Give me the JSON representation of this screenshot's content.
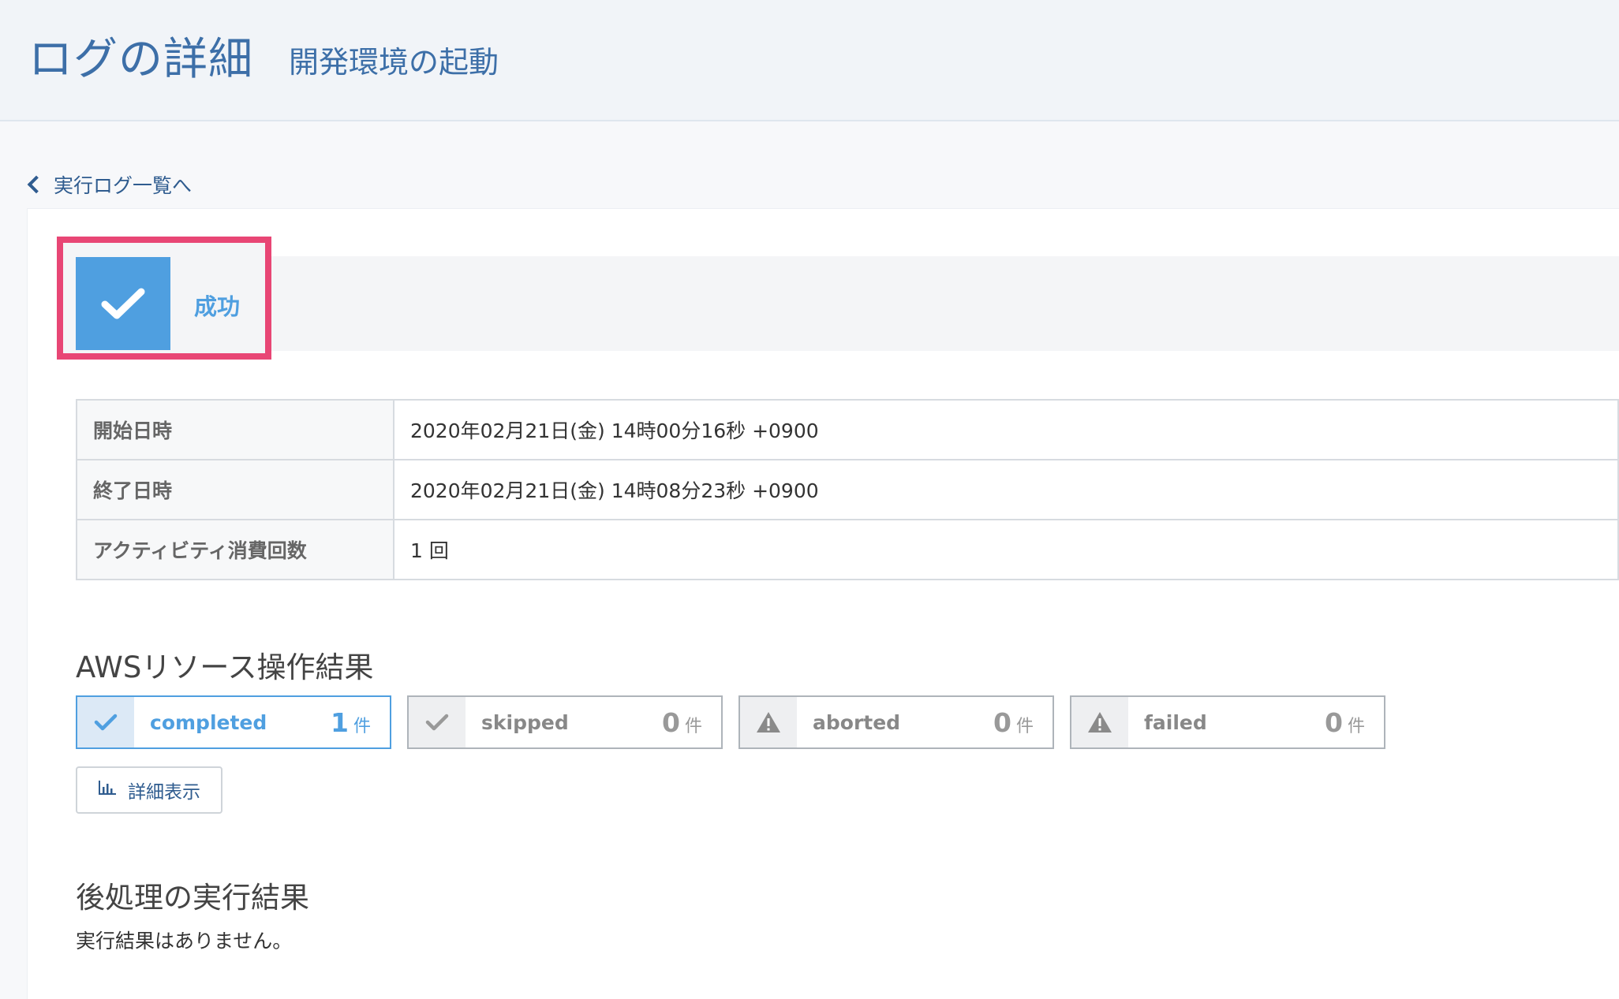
{
  "header": {
    "title": "ログの詳細",
    "subtitle": "開発環境の起動"
  },
  "back_link": {
    "label": "実行ログ一覧へ"
  },
  "status": {
    "label": "成功",
    "icon": "check-icon",
    "color": "#4f9fe0",
    "highlight_color": "#e84675"
  },
  "info_rows": [
    {
      "label": "開始日時",
      "value": "2020年02月21日(金) 14時00分16秒 +0900"
    },
    {
      "label": "終了日時",
      "value": "2020年02月21日(金) 14時08分23秒 +0900"
    },
    {
      "label": "アクティビティ消費回数",
      "value": "1 回"
    }
  ],
  "aws_results": {
    "title": "AWSリソース操作結果",
    "unit": "件",
    "items": [
      {
        "label": "completed",
        "count": "1",
        "icon": "check-icon"
      },
      {
        "label": "skipped",
        "count": "0",
        "icon": "check-icon"
      },
      {
        "label": "aborted",
        "count": "0",
        "icon": "warning-icon"
      },
      {
        "label": "failed",
        "count": "0",
        "icon": "warning-icon"
      }
    ],
    "detail_button": {
      "label": "詳細表示",
      "icon": "bar-chart-icon"
    }
  },
  "post_process": {
    "title": "後処理の実行結果",
    "message": "実行結果はありません。"
  }
}
